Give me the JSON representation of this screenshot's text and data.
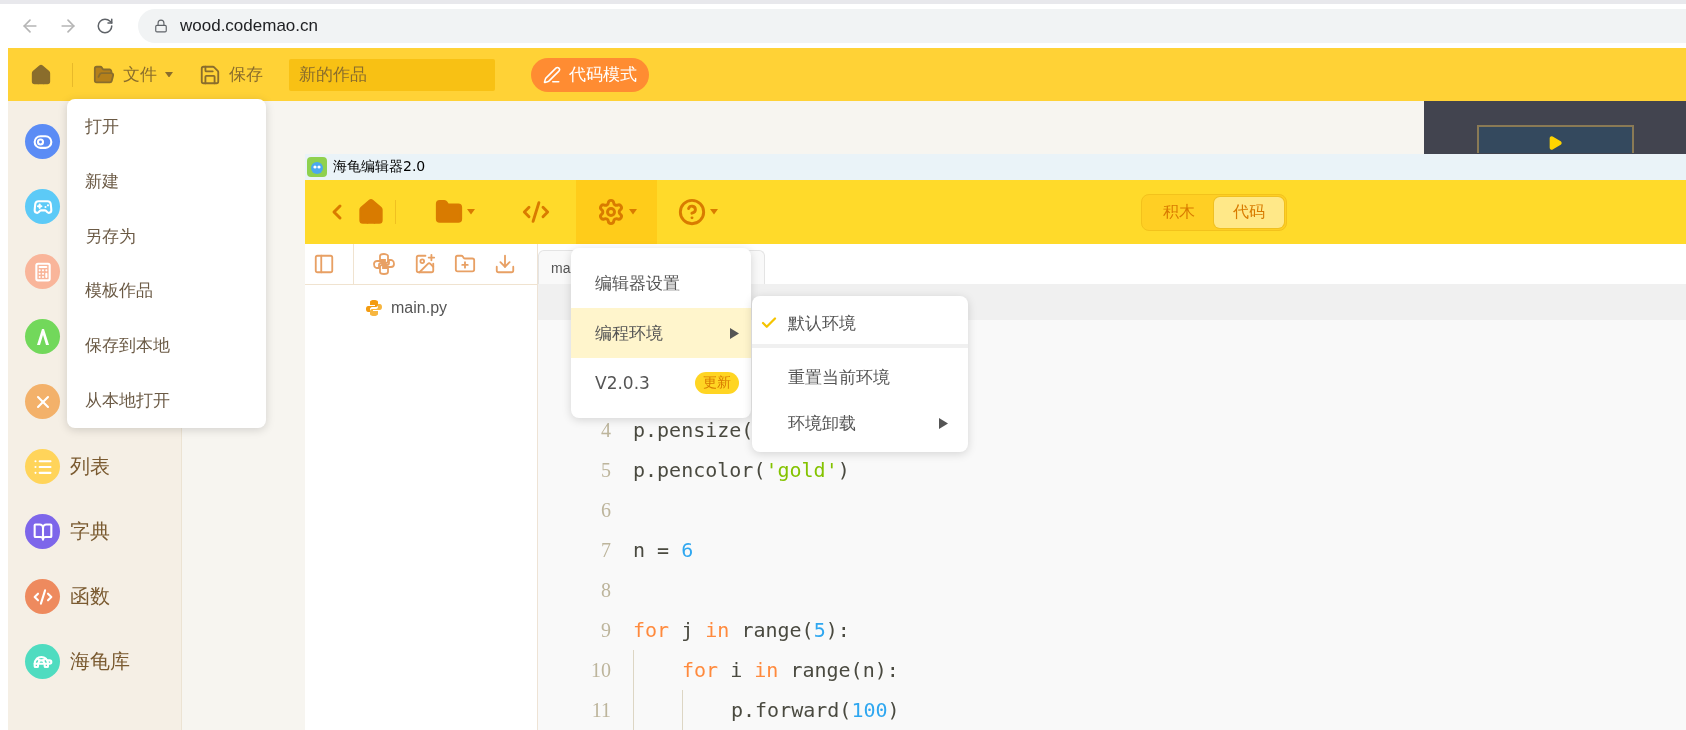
{
  "browser": {
    "url": "wood.codemao.cn"
  },
  "app_bar": {
    "file_label": "文件",
    "save_label": "保存",
    "title_field": {
      "value": "新的作品"
    },
    "mode_button": "代码模式"
  },
  "sidebar": {
    "items": [
      {
        "kind": "toggle",
        "color": "#5b8cf5"
      },
      {
        "kind": "gamepad",
        "color": "#5ccaf7"
      },
      {
        "kind": "math",
        "color": "#f9b59a"
      },
      {
        "kind": "letter",
        "color": "#72d85b"
      },
      {
        "kind": "cross",
        "color": "#f3b16a"
      },
      {
        "kind": "list",
        "color": "#ffd45a",
        "label": "列表"
      },
      {
        "kind": "book",
        "color": "#7d66ea",
        "label": "字典"
      },
      {
        "kind": "code",
        "color": "#ee8a5e",
        "label": "函数"
      },
      {
        "kind": "turtle",
        "color": "#4fdcc0",
        "label": "海龟库"
      }
    ]
  },
  "file_menu": {
    "items": [
      "打开",
      "新建",
      "另存为",
      "模板作品",
      "保存到本地",
      "从本地打开"
    ]
  },
  "editor": {
    "title": "海龟编辑器2.0",
    "tools": [
      {
        "kind": "folder",
        "dropdown": true,
        "selected": false
      },
      {
        "kind": "code",
        "dropdown": false,
        "selected": false
      },
      {
        "kind": "settings",
        "dropdown": true,
        "selected": true
      },
      {
        "kind": "help",
        "dropdown": true,
        "selected": false
      }
    ],
    "mode_toggle": [
      {
        "label": "积木",
        "selected": false
      },
      {
        "label": "代码",
        "selected": true
      }
    ],
    "files": [
      {
        "name": "main.py"
      }
    ],
    "tab": {
      "label": "ma"
    },
    "code_lines": [
      {
        "number": "4",
        "tokens": [
          {
            "kind": "plain",
            "text": "p.pensize("
          }
        ]
      },
      {
        "number": "5",
        "tokens": [
          {
            "kind": "plain",
            "text": "p.pencolor("
          },
          {
            "kind": "string",
            "text": "'gold'"
          },
          {
            "kind": "plain",
            "text": ")"
          }
        ]
      },
      {
        "number": "6"
      },
      {
        "number": "7",
        "tokens": [
          {
            "kind": "plain",
            "text": "n = "
          },
          {
            "kind": "number",
            "text": "6"
          }
        ]
      },
      {
        "number": "8"
      },
      {
        "number": "9",
        "tokens": [
          {
            "kind": "keyword",
            "text": "for"
          },
          {
            "kind": "plain",
            "text": " j "
          },
          {
            "kind": "keyword",
            "text": "in"
          },
          {
            "kind": "plain",
            "text": " range("
          },
          {
            "kind": "number",
            "text": "5"
          },
          {
            "kind": "plain",
            "text": "):"
          }
        ],
        "children": [
          {
            "number": "10",
            "tokens": [
              {
                "kind": "keyword",
                "text": "for"
              },
              {
                "kind": "plain",
                "text": " i "
              },
              {
                "kind": "keyword",
                "text": "in"
              },
              {
                "kind": "plain",
                "text": " range(n):"
              }
            ],
            "children": [
              {
                "number": "11",
                "tokens": [
                  {
                    "kind": "plain",
                    "text": "p.forward("
                  },
                  {
                    "kind": "number",
                    "text": "100"
                  },
                  {
                    "kind": "plain",
                    "text": ")"
                  }
                ]
              }
            ]
          }
        ]
      }
    ],
    "settings_menu": {
      "items": [
        {
          "label": "编辑器设置",
          "selected": false,
          "submenu": false
        },
        {
          "label": "编程环境",
          "selected": true,
          "submenu": true
        },
        {
          "label": "V2.0.3",
          "selected": false,
          "submenu": false,
          "badge": "更新"
        }
      ]
    },
    "env_submenu": {
      "items": [
        {
          "label": "默认环境",
          "checked": true,
          "submenu": false,
          "separator_after": true
        },
        {
          "label": "重置当前环境",
          "checked": false,
          "submenu": false,
          "separator_after": false
        },
        {
          "label": "环境卸载",
          "checked": false,
          "submenu": true,
          "separator_after": false
        }
      ]
    }
  }
}
